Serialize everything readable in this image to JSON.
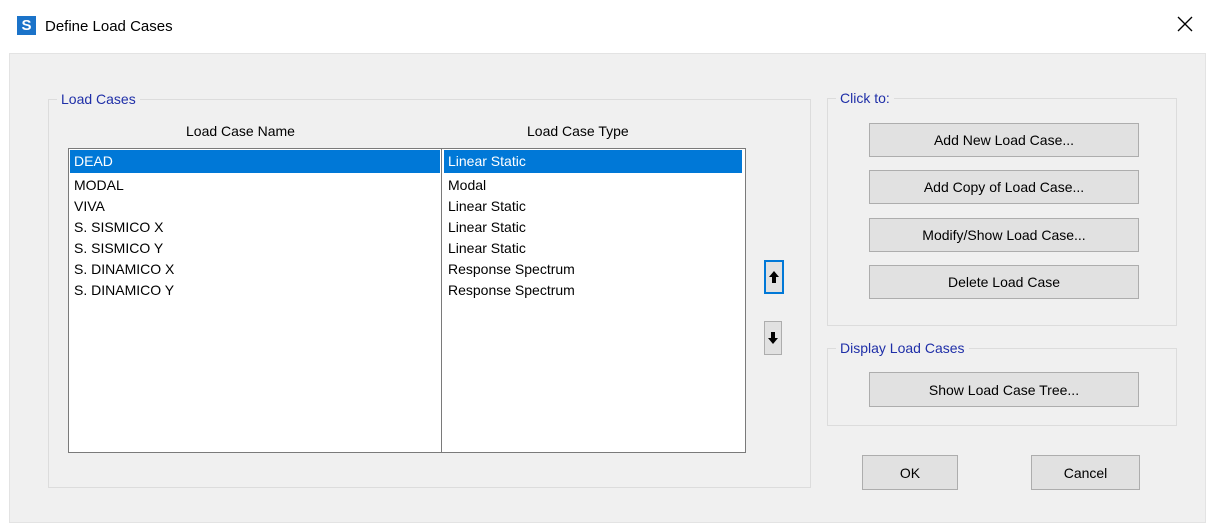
{
  "window": {
    "app_icon_letter": "S",
    "title": "Define Load Cases",
    "close_icon": "close-icon"
  },
  "load_cases_group": {
    "legend": "Load Cases",
    "col_name_header": "Load Case Name",
    "col_type_header": "Load Case Type",
    "rows": [
      {
        "name": "DEAD",
        "type": "Linear Static",
        "selected": true
      },
      {
        "name": "MODAL",
        "type": "Modal",
        "selected": false
      },
      {
        "name": "VIVA",
        "type": "Linear Static",
        "selected": false
      },
      {
        "name": "S. SISMICO X",
        "type": "Linear Static",
        "selected": false
      },
      {
        "name": "S. SISMICO Y",
        "type": "Linear Static",
        "selected": false
      },
      {
        "name": "S. DINAMICO X",
        "type": "Response Spectrum",
        "selected": false
      },
      {
        "name": "S. DINAMICO Y",
        "type": "Response Spectrum",
        "selected": false
      }
    ],
    "move_up_icon": "arrow-up-icon",
    "move_down_icon": "arrow-down-icon"
  },
  "click_to_group": {
    "legend": "Click to:",
    "add_new": "Add New Load Case...",
    "add_copy": "Add Copy of Load Case...",
    "modify_show": "Modify/Show Load Case...",
    "delete": "Delete Load Case"
  },
  "display_group": {
    "legend": "Display Load Cases",
    "show_tree": "Show Load Case Tree..."
  },
  "footer": {
    "ok": "OK",
    "cancel": "Cancel"
  },
  "colors": {
    "selection": "#0078d7",
    "legend_text": "#1f2fa8",
    "app_icon": "#1b73c9",
    "dialog_bg": "#f0f0f0"
  }
}
